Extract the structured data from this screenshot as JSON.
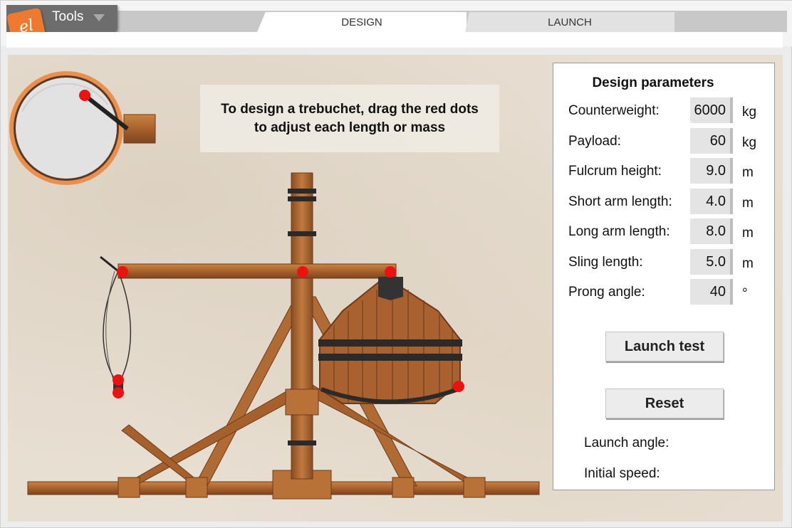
{
  "toolbar": {
    "logo_text": "el",
    "tools_label": "Tools"
  },
  "tabs": [
    {
      "label": "DESIGN",
      "active": true
    },
    {
      "label": "LAUNCH",
      "active": false
    }
  ],
  "instructions": "To design a trebuchet, drag the red dots to adjust each length or mass",
  "params": {
    "title": "Design parameters",
    "rows": [
      {
        "label": "Counterweight:",
        "value": "6000",
        "unit": "kg"
      },
      {
        "label": "Payload:",
        "value": "60",
        "unit": "kg"
      },
      {
        "label": "Fulcrum height:",
        "value": "9.0",
        "unit": "m"
      },
      {
        "label": "Short arm length:",
        "value": "4.0",
        "unit": "m"
      },
      {
        "label": "Long arm length:",
        "value": "8.0",
        "unit": "m"
      },
      {
        "label": "Sling length:",
        "value": "5.0",
        "unit": "m"
      },
      {
        "label": "Prong angle:",
        "value": "40",
        "unit": "°"
      }
    ],
    "launch_test_label": "Launch test",
    "reset_label": "Reset",
    "launch_angle_label": "Launch angle:",
    "initial_speed_label": "Initial speed:"
  },
  "colors": {
    "accent": "#ef7a2f",
    "handle": "#ee1111",
    "wood": "#a9622f",
    "wood_dark": "#7c4420"
  }
}
